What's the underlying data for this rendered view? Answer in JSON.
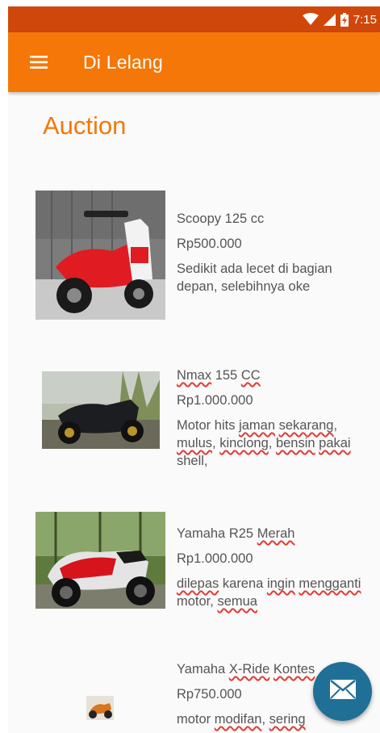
{
  "status_bar": {
    "time": "7:15",
    "icons": [
      "wifi-icon",
      "signal-icon",
      "battery-charging-icon"
    ]
  },
  "app_bar": {
    "title": "Di Lelang",
    "menu_icon": "hamburger-menu-icon"
  },
  "page": {
    "title": "Auction"
  },
  "items": [
    {
      "name": "Scoopy 125 cc",
      "price": "Rp500.000",
      "description": "Sedikit ada lecet di bagian depan, selebihnya oke",
      "photo": "red-white-scooter-photo"
    },
    {
      "name": "Nmax 155 CC",
      "price": "Rp1.000.000",
      "description": "Motor hits jaman sekarang, mulus, kinclong, bensin pakai shell,",
      "photo": "black-scooter-photo"
    },
    {
      "name": "Yamaha R25 Merah",
      "price": "Rp1.000.000",
      "description": "dilepas karena ingin mengganti motor, semua",
      "photo": "red-sport-bike-photo"
    },
    {
      "name": "Yamaha X-Ride Kontes",
      "price": "Rp750.000",
      "description": "motor modifan, sering",
      "photo": "modified-bike-photo"
    }
  ],
  "fab": {
    "icon": "mail-icon"
  },
  "colors": {
    "status_bar": "#d0470b",
    "app_bar": "#f57708",
    "accent": "#f57708",
    "fab": "#1f6f96",
    "text": "#555555"
  }
}
